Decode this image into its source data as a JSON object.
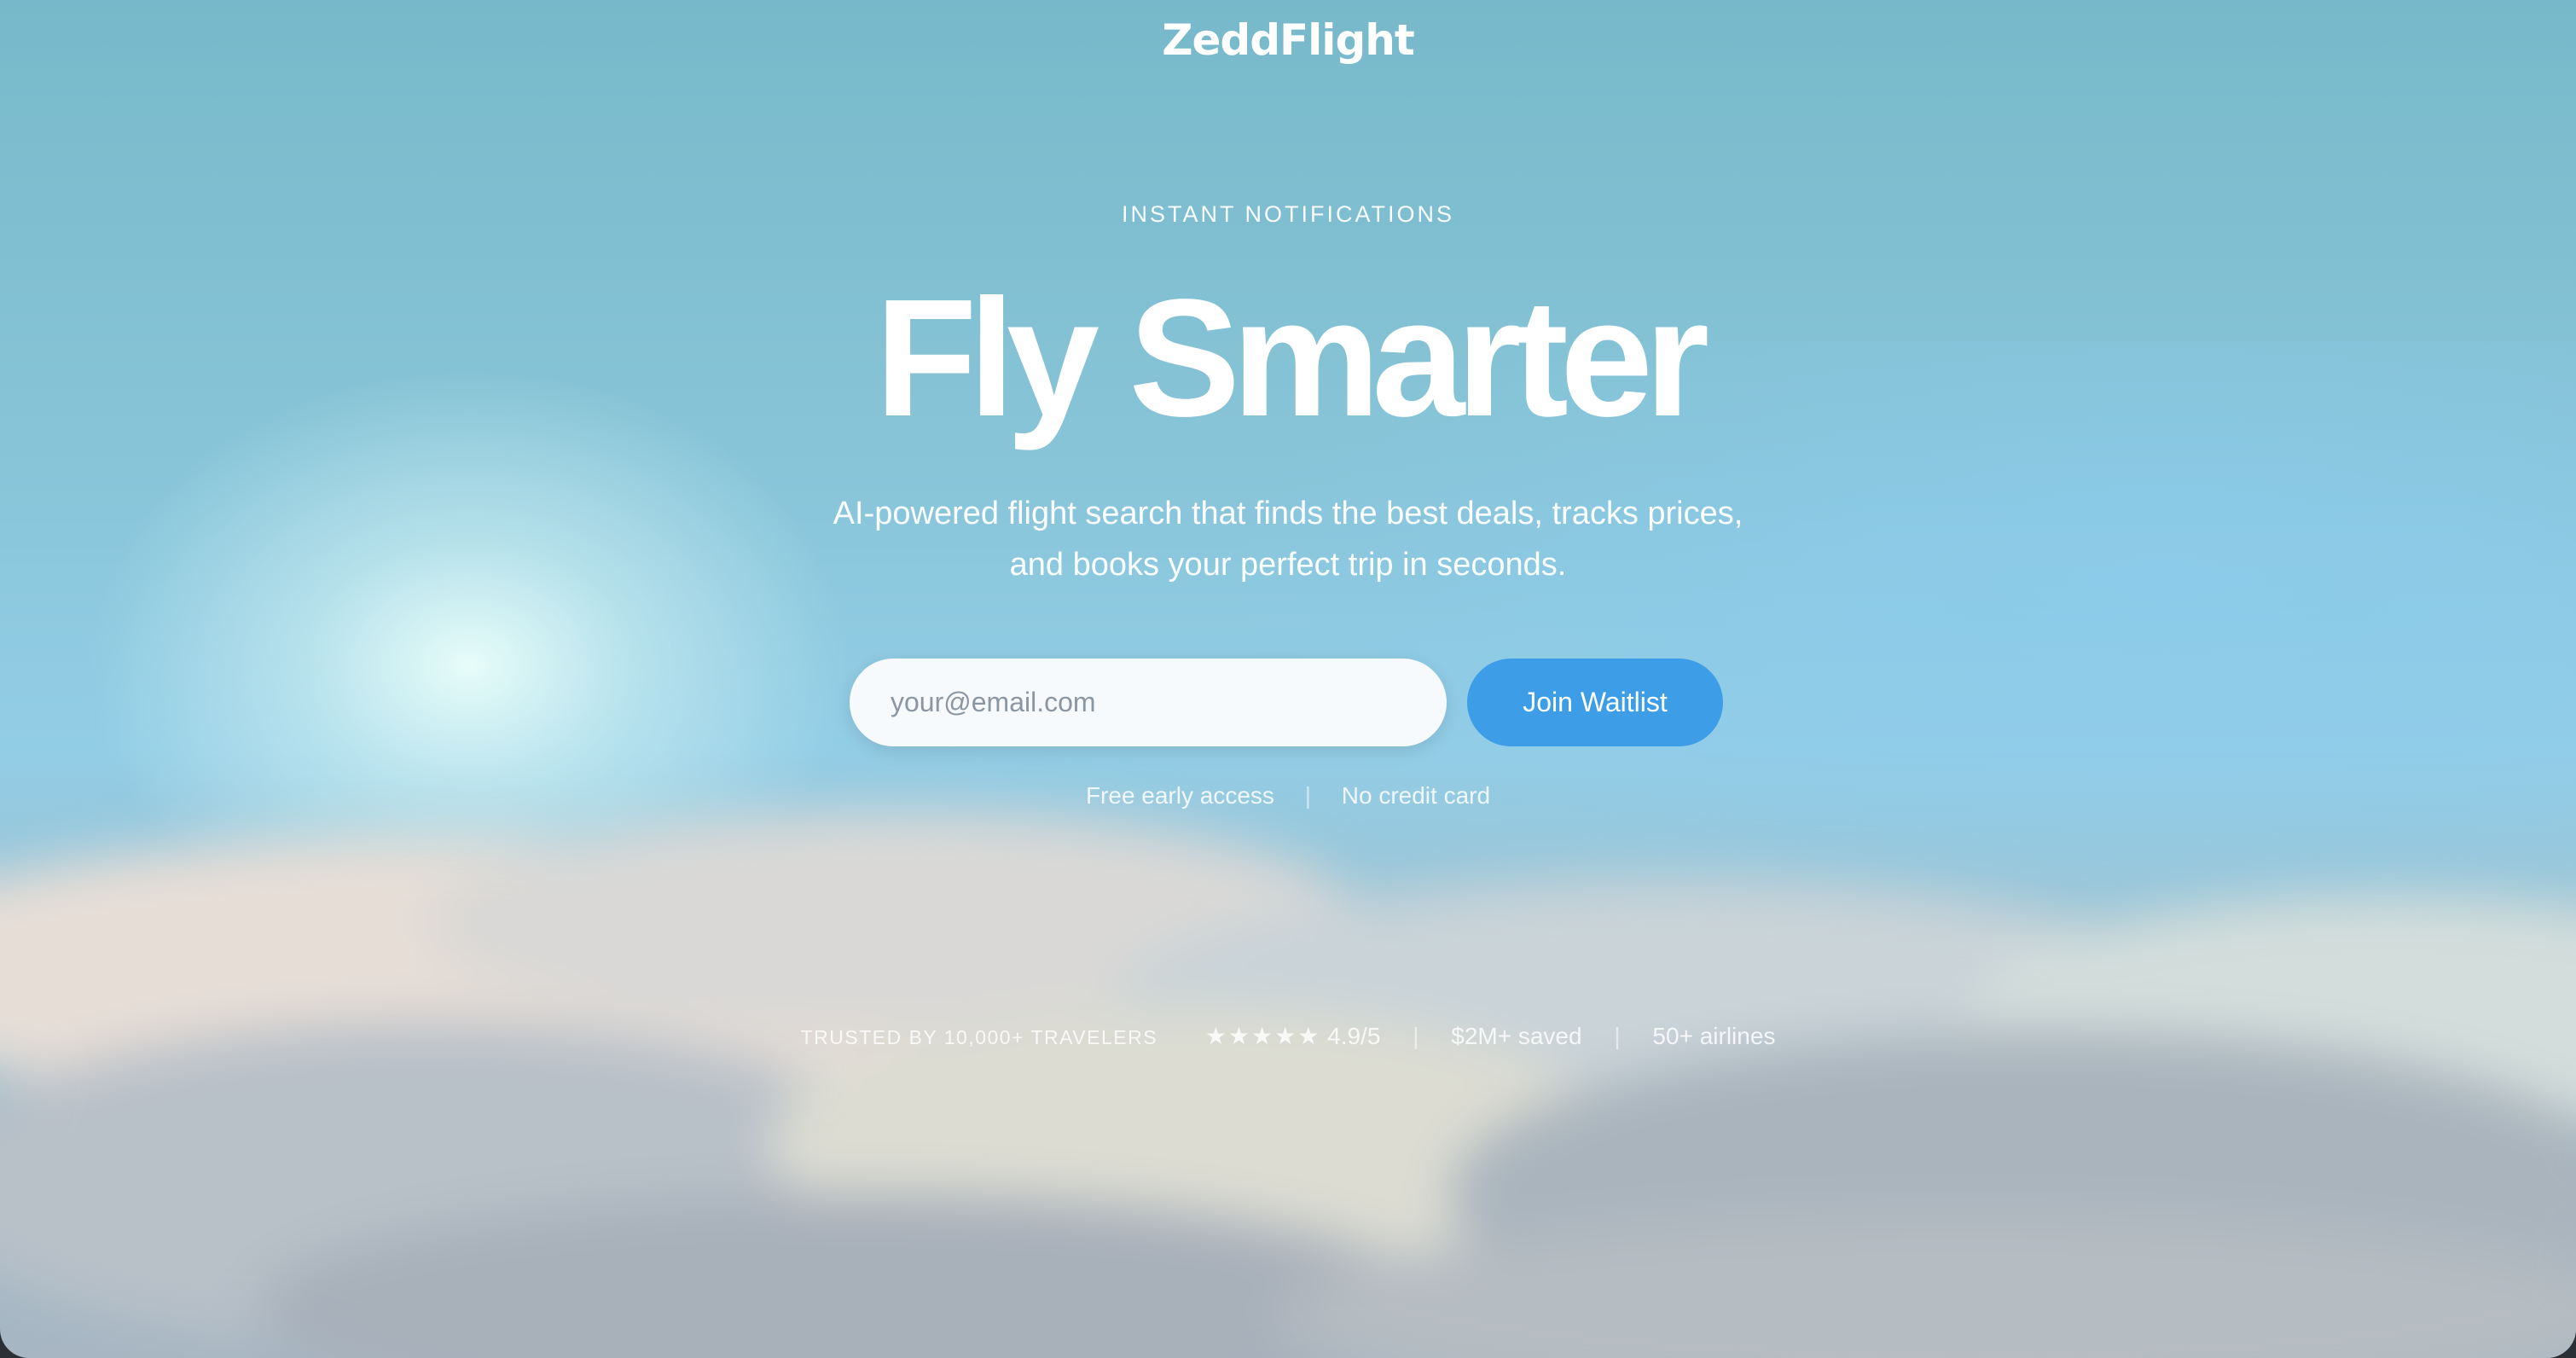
{
  "brand": {
    "name": "ZeddFlight"
  },
  "hero": {
    "eyebrow": "INSTANT NOTIFICATIONS",
    "headline": "Fly Smarter",
    "subtitle_line1": "AI-powered flight search that finds the best deals, tracks prices,",
    "subtitle_line2": "and books your perfect trip in seconds."
  },
  "signup": {
    "email_placeholder": "your@email.com",
    "email_value": "",
    "button_label": "Join Waitlist",
    "perk_1": "Free early access",
    "perk_2": "No credit card"
  },
  "trust": {
    "label": "TRUSTED BY 10,000+ TRAVELERS",
    "stars": "★★★★★",
    "rating": "4.9/5",
    "saved": "$2M+ saved",
    "airlines": "50+ airlines"
  },
  "colors": {
    "sky": "#86c3d6",
    "button": "#3d9de6",
    "input_bg": "#f6fafc",
    "text": "#ffffff"
  }
}
